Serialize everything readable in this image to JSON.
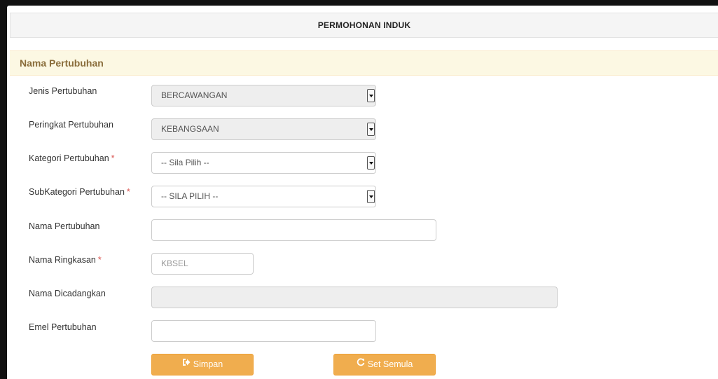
{
  "header": {
    "title": "PERMOHONAN INDUK"
  },
  "section": {
    "title": "Nama Pertubuhan"
  },
  "form": {
    "jenis": {
      "label": "Jenis Pertubuhan",
      "value": "BERCAWANGAN"
    },
    "peringkat": {
      "label": "Peringkat Pertubuhan",
      "value": "KEBANGSAAN"
    },
    "kategori": {
      "label": "Kategori Pertubuhan",
      "required": "*",
      "value": "-- Sila Pilih --"
    },
    "subkategori": {
      "label": "SubKategori Pertubuhan",
      "required": "*",
      "value": "-- SILA PILIH --"
    },
    "nama": {
      "label": "Nama Pertubuhan",
      "value": ""
    },
    "ringkasan": {
      "label": "Nama Ringkasan",
      "required": "*",
      "placeholder": "KBSEL"
    },
    "dicadangkan": {
      "label": "Nama Dicadangkan",
      "value": ""
    },
    "emel": {
      "label": "Emel Pertubuhan",
      "value": ""
    }
  },
  "buttons": {
    "simpan": {
      "label": "Simpan",
      "icon": "save-icon"
    },
    "set_semula": {
      "label": "Set Semula",
      "icon": "refresh-icon"
    }
  },
  "colors": {
    "accent": "#f0ad4e",
    "section_bg": "#fcf8e3",
    "section_text": "#8a6d3b",
    "required": "#d9534f"
  }
}
